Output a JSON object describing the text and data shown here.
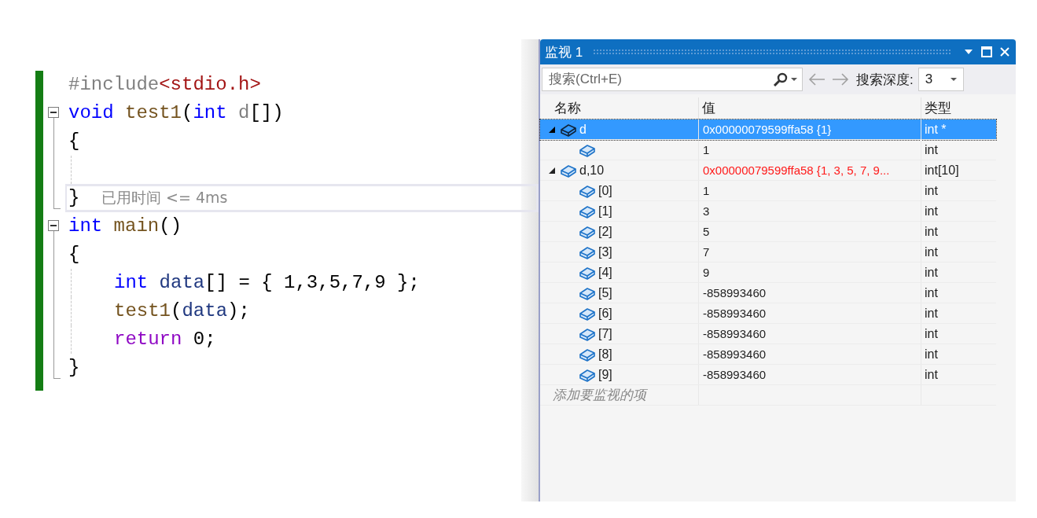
{
  "editor": {
    "lines": [
      {
        "kind": "plain",
        "guide": false,
        "indented": false,
        "tokens": [
          {
            "text": "#include",
            "kind": "preproc"
          },
          {
            "text": "<stdio.h>",
            "kind": "string"
          }
        ]
      },
      {
        "kind": "fold_start",
        "guide": false,
        "indented": false,
        "tokens": [
          {
            "text": "void",
            "kind": "keyword"
          },
          {
            "text": " test1",
            "kind": "function"
          },
          {
            "text": "(",
            "kind": "plain"
          },
          {
            "text": "int",
            "kind": "keyword"
          },
          {
            "text": " d",
            "kind": "param"
          },
          {
            "text": "[])",
            "kind": "plain"
          }
        ]
      },
      {
        "kind": "fold_inner",
        "guide": false,
        "indented": false,
        "tokens": [
          {
            "text": "{",
            "kind": "plain"
          }
        ]
      },
      {
        "kind": "fold_inner",
        "guide": true,
        "indented": false
      },
      {
        "kind": "fold_end",
        "guide": false,
        "indented": false,
        "tokens": [
          {
            "text": "}",
            "kind": "plain"
          }
        ],
        "hint": "已用时间 <= 4ms"
      },
      {
        "kind": "fold_start",
        "guide": false,
        "indented": false,
        "tokens": [
          {
            "text": "int",
            "kind": "keyword"
          },
          {
            "text": " main",
            "kind": "function"
          },
          {
            "text": "()",
            "kind": "plain"
          }
        ]
      },
      {
        "kind": "fold_inner",
        "guide": false,
        "indented": false,
        "tokens": [
          {
            "text": "{",
            "kind": "plain"
          }
        ]
      },
      {
        "kind": "fold_inner",
        "guide": true,
        "indented": true,
        "tokens": [
          {
            "text": "int",
            "kind": "keyword"
          },
          {
            "text": " data",
            "kind": "local"
          },
          {
            "text": "[] = { 1,3,5,7,9 };",
            "kind": "plain"
          }
        ]
      },
      {
        "kind": "fold_inner",
        "guide": true,
        "indented": true,
        "tokens": [
          {
            "text": "test1",
            "kind": "function"
          },
          {
            "text": "(",
            "kind": "plain"
          },
          {
            "text": "data",
            "kind": "local"
          },
          {
            "text": ");",
            "kind": "plain"
          }
        ]
      },
      {
        "kind": "fold_inner",
        "guide": true,
        "indented": true,
        "tokens": [
          {
            "text": "return",
            "kind": "control"
          },
          {
            "text": " 0;",
            "kind": "plain"
          }
        ]
      },
      {
        "kind": "fold_end",
        "guide": false,
        "indented": false,
        "tokens": [
          {
            "text": "}",
            "kind": "plain"
          }
        ]
      }
    ]
  },
  "watch": {
    "title": "监视 1",
    "search": {
      "placeholder": "搜索(Ctrl+E)"
    },
    "depth_label": "搜索深度:",
    "depth_value": "3",
    "columns": [
      "名称",
      "值",
      "类型"
    ],
    "rows": [
      {
        "name": "d",
        "value": "0x00000079599ffa58 {1}",
        "type": "int *",
        "selected": true,
        "changed": false,
        "expanded": true,
        "children": [
          {
            "value": "1",
            "type": "int",
            "selected": false,
            "changed": false
          }
        ]
      },
      {
        "name": "d,10",
        "value": "0x00000079599ffa58 {1, 3, 5, 7, 9...",
        "type": "int[10]",
        "selected": false,
        "changed": true,
        "expanded": true,
        "children": [
          {
            "name": "[0]",
            "value": "1",
            "type": "int",
            "selected": false,
            "changed": false
          },
          {
            "name": "[1]",
            "value": "3",
            "type": "int",
            "selected": false,
            "changed": false
          },
          {
            "name": "[2]",
            "value": "5",
            "type": "int",
            "selected": false,
            "changed": false
          },
          {
            "name": "[3]",
            "value": "7",
            "type": "int",
            "selected": false,
            "changed": false
          },
          {
            "name": "[4]",
            "value": "9",
            "type": "int",
            "selected": false,
            "changed": false
          },
          {
            "name": "[5]",
            "value": "-858993460",
            "type": "int",
            "selected": false,
            "changed": false
          },
          {
            "name": "[6]",
            "value": "-858993460",
            "type": "int",
            "selected": false,
            "changed": false
          },
          {
            "name": "[7]",
            "value": "-858993460",
            "type": "int",
            "selected": false,
            "changed": false
          },
          {
            "name": "[8]",
            "value": "-858993460",
            "type": "int",
            "selected": false,
            "changed": false
          },
          {
            "name": "[9]",
            "value": "-858993460",
            "type": "int",
            "selected": false,
            "changed": false
          }
        ]
      }
    ],
    "add_placeholder": "添加要监视的项"
  }
}
